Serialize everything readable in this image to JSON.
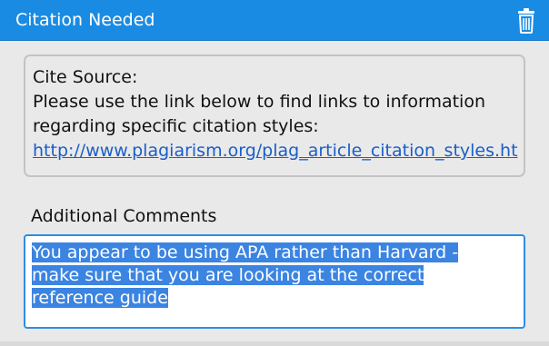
{
  "header": {
    "title": "Citation Needed",
    "icon": "trash-icon",
    "color": "#1a8be3"
  },
  "comment": {
    "heading": "Cite Source:",
    "body_line1": "Please use the link below to find links to information",
    "body_line2": "regarding specific citation styles:",
    "link_text": "http://www.plagiarism.org/plag_article_citation_styles.ht"
  },
  "additional": {
    "label": "Additional Comments",
    "value_line1": "You appear to be using APA rather than Harvard -",
    "value_line2": "make sure that you are looking at the correct",
    "value_line3": "reference guide",
    "selection_color": "#3b84e2"
  }
}
